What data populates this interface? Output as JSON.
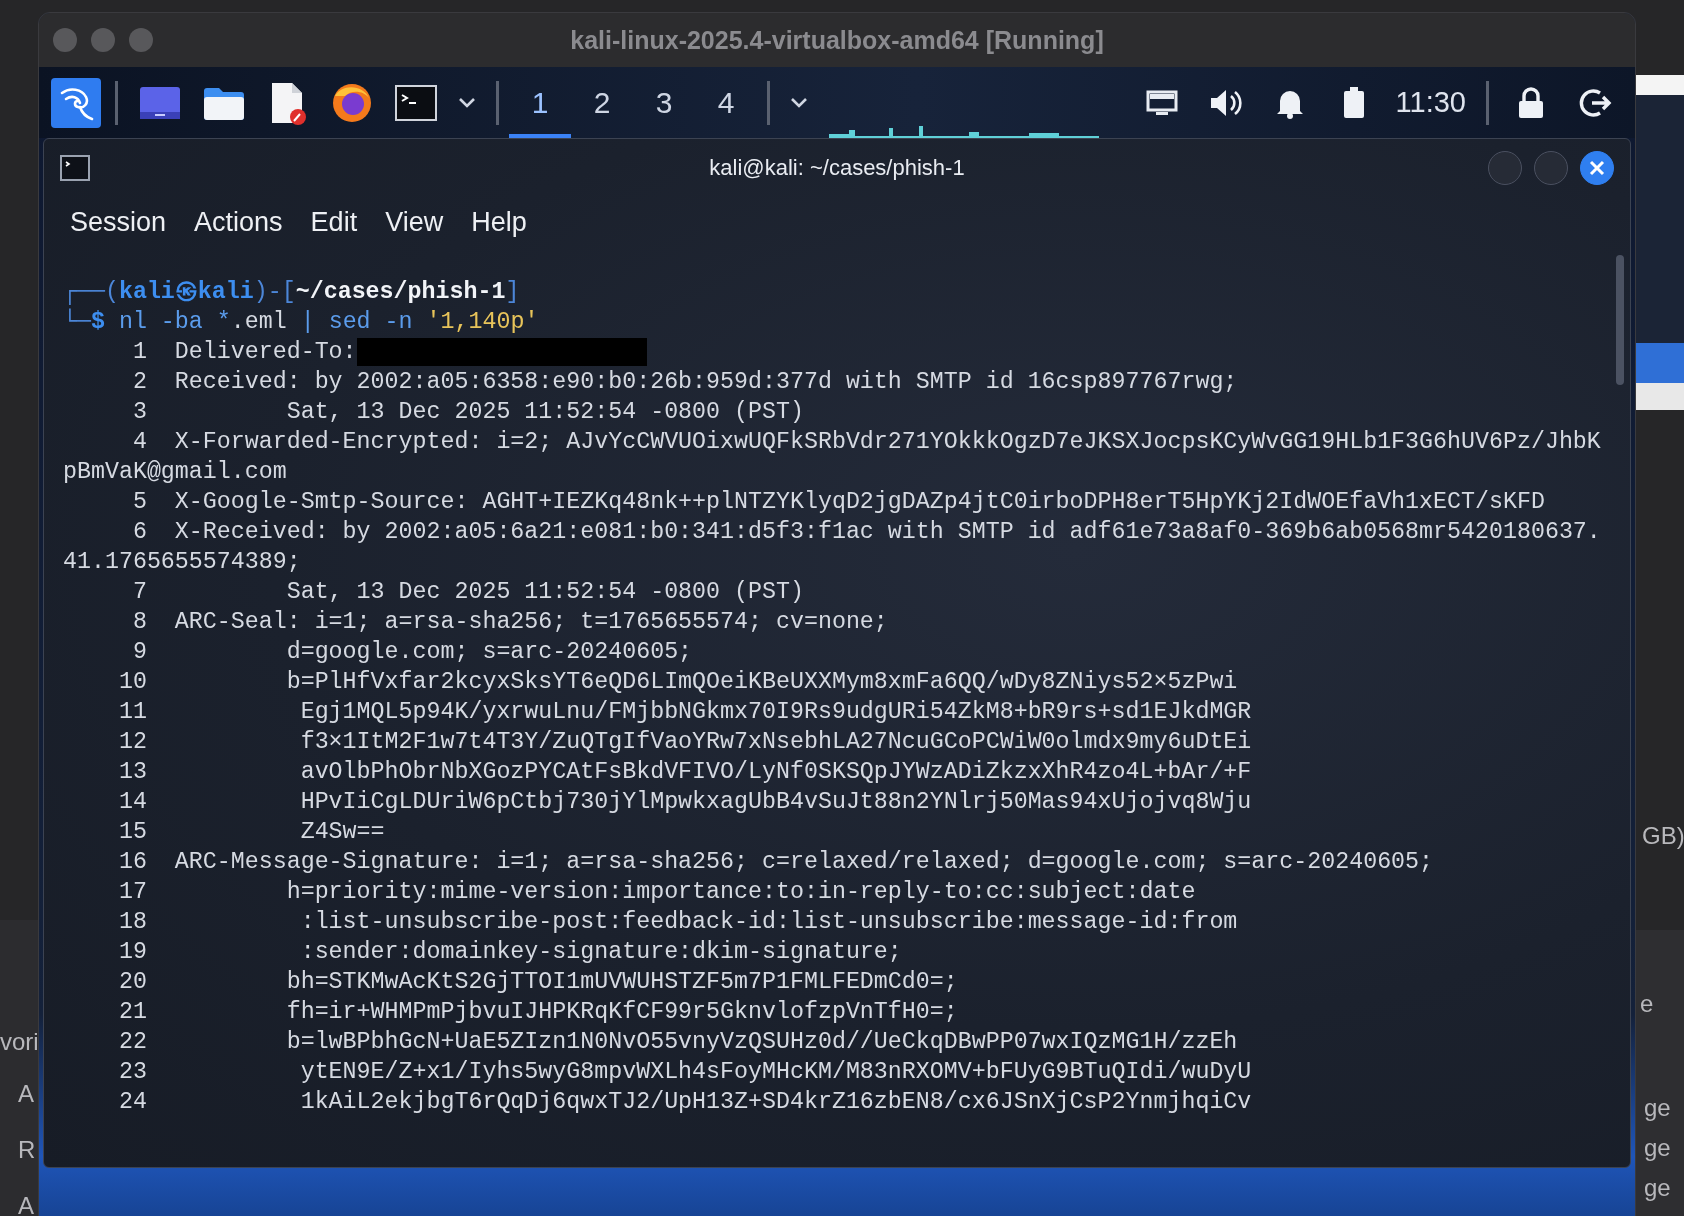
{
  "background_left": [
    "vori",
    "A",
    "R",
    "A"
  ],
  "background_right": [
    "GB)",
    "e",
    "ge",
    "ge",
    "ge"
  ],
  "vm_window": {
    "title": "kali-linux-2025.4-virtualbox-amd64 [Running]"
  },
  "panel": {
    "workspaces": [
      {
        "label": "1",
        "selected": true
      },
      {
        "label": "2",
        "selected": false
      },
      {
        "label": "3",
        "selected": false
      },
      {
        "label": "4",
        "selected": false
      }
    ],
    "clock": "11:30"
  },
  "terminal": {
    "title": "kali@kali: ~/cases/phish-1",
    "menu": [
      "Session",
      "Actions",
      "Edit",
      "View",
      "Help"
    ],
    "prompt": [
      [
        {
          "text": "┌──(",
          "kind": "frame"
        },
        {
          "text": "kali㉿kali",
          "kind": "user"
        },
        {
          "text": ")-[",
          "kind": "frame"
        },
        {
          "text": "~/cases/phish-1",
          "kind": "path"
        },
        {
          "text": "]",
          "kind": "frame"
        }
      ],
      [
        {
          "text": "└─",
          "kind": "frame"
        },
        {
          "text": "$",
          "kind": "dollar"
        },
        {
          "text": " nl -ba ",
          "kind": "cmd"
        },
        {
          "text": "*",
          "kind": "cmd"
        },
        {
          "text": ".eml ",
          "kind": "plain"
        },
        {
          "text": "|",
          "kind": "cmd"
        },
        {
          "text": " sed -n ",
          "kind": "cmd"
        },
        {
          "text": "'1,140p'",
          "kind": "string"
        }
      ]
    ],
    "rows": [
      {
        "kind": "numbered",
        "number": "1",
        "text": "Delivered-To:",
        "redacted": true
      },
      {
        "kind": "numbered",
        "number": "2",
        "text": "Received: by 2002:a05:6358:e90:b0:26b:959d:377d with SMTP id 16csp897767rwg;",
        "redacted": false
      },
      {
        "kind": "numbered",
        "number": "3",
        "text": "        Sat, 13 Dec 2025 11:52:54 -0800 (PST)",
        "redacted": false
      },
      {
        "kind": "numbered",
        "number": "4",
        "text": "X-Forwarded-Encrypted: i=2; AJvYcCWVUOixwUQFkSRbVdr271YOkkkOgzD7eJKSXJocpsKCyWvGG19HLb1F3G6hUV6Pz/JhbK",
        "redacted": false
      },
      {
        "kind": "wrap",
        "text": "pBmVaK@gmail.com"
      },
      {
        "kind": "numbered",
        "number": "5",
        "text": "X-Google-Smtp-Source: AGHT+IEZKq48nk++plNTZYKlyqD2jgDAZp4jtC0irboDPH8erT5HpYKj2IdWOEfaVh1xECT/sKFD",
        "redacted": false
      },
      {
        "kind": "numbered",
        "number": "6",
        "text": "X-Received: by 2002:a05:6a21:e081:b0:341:d5f3:f1ac with SMTP id adf61e73a8af0-369b6ab0568mr5420180637.",
        "redacted": false
      },
      {
        "kind": "wrap",
        "text": "41.1765655574389;"
      },
      {
        "kind": "numbered",
        "number": "7",
        "text": "        Sat, 13 Dec 2025 11:52:54 -0800 (PST)",
        "redacted": false
      },
      {
        "kind": "numbered",
        "number": "8",
        "text": "ARC-Seal: i=1; a=rsa-sha256; t=1765655574; cv=none;",
        "redacted": false
      },
      {
        "kind": "numbered",
        "number": "9",
        "text": "        d=google.com; s=arc-20240605;",
        "redacted": false
      },
      {
        "kind": "numbered",
        "number": "10",
        "text": "        b=PlHfVxfar2kcyxSksYT6eQD6LImQOeiKBeUXXMym8xmFa6QQ/wDy8ZNiys52×5zPwi",
        "redacted": false
      },
      {
        "kind": "numbered",
        "number": "11",
        "text": "         Egj1MQL5p94K/yxrwuLnu/FMjbbNGkmx70I9Rs9udgURi54ZkM8+bR9rs+sd1EJkdMGR",
        "redacted": false
      },
      {
        "kind": "numbered",
        "number": "12",
        "text": "         f3×1ItM2F1w7t4T3Y/ZuQTgIfVaoYRw7xNsebhLA27NcuGCoPCWiW0olmdx9my6uDtEi",
        "redacted": false
      },
      {
        "kind": "numbered",
        "number": "13",
        "text": "         avOlbPhObrNbXGozPYCAtFsBkdVFIVO/LyNf0SKSQpJYWzADiZkzxXhR4zo4L+bAr/+F",
        "redacted": false
      },
      {
        "kind": "numbered",
        "number": "14",
        "text": "         HPvIiCgLDUriW6pCtbj730jYlMpwkxagUbB4vSuJt88n2YNlrj50Mas94xUjojvq8Wju",
        "redacted": false
      },
      {
        "kind": "numbered",
        "number": "15",
        "text": "         Z4Sw==",
        "redacted": false
      },
      {
        "kind": "numbered",
        "number": "16",
        "text": "ARC-Message-Signature: i=1; a=rsa-sha256; c=relaxed/relaxed; d=google.com; s=arc-20240605;",
        "redacted": false
      },
      {
        "kind": "numbered",
        "number": "17",
        "text": "        h=priority:mime-version:importance:to:in-reply-to:cc:subject:date",
        "redacted": false
      },
      {
        "kind": "numbered",
        "number": "18",
        "text": "         :list-unsubscribe-post:feedback-id:list-unsubscribe:message-id:from",
        "redacted": false
      },
      {
        "kind": "numbered",
        "number": "19",
        "text": "         :sender:domainkey-signature:dkim-signature;",
        "redacted": false
      },
      {
        "kind": "numbered",
        "number": "20",
        "text": "        bh=STKMwAcKtS2GjTTOI1mUVWUHSTZF5m7P1FMLFEDmCd0=;",
        "redacted": false
      },
      {
        "kind": "numbered",
        "number": "21",
        "text": "        fh=ir+WHMPmPjbvuIJHPKRqKfCF99r5GknvlofzpVnTfH0=;",
        "redacted": false
      },
      {
        "kind": "numbered",
        "number": "22",
        "text": "        b=lwBPbhGcN+UaE5ZIzn1N0NvO55vnyVzQSUHz0d//UeCkqDBwPP07wxIQzMG1H/zzEh",
        "redacted": false
      },
      {
        "kind": "numbered",
        "number": "23",
        "text": "         ytEN9E/Z+x1/Iyhs5wyG8mpvWXLh4sFoyMHcKM/M83nRXOMV+bFUyG9BTuQIdi/wuDyU",
        "redacted": false
      },
      {
        "kind": "numbered",
        "number": "24",
        "text": "         1kAiL2ekjbgT6rQqDj6qwxTJ2/UpH13Z+SD4krZ16zbEN8/cx6JSnXjCsP2YnmjhqiCv",
        "redacted": false
      }
    ]
  }
}
